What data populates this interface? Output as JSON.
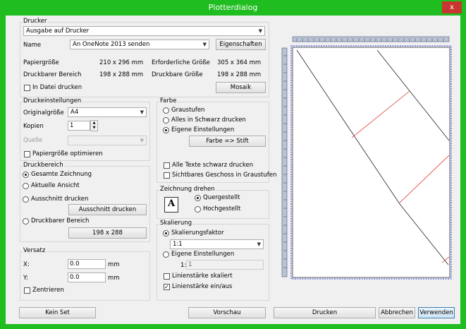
{
  "window": {
    "title": "Plotterdialog",
    "close_label": "x"
  },
  "drucker": {
    "group_title": "Drucker",
    "output_select": "Ausgabe auf Drucker",
    "name_label": "Name",
    "name_select": "An OneNote 2013 senden",
    "properties_button": "Eigenschaften",
    "papiergroesse_label": "Papiergröße",
    "papiergroesse_value": "210 x 296 mm",
    "erforderlich_label": "Erforderliche Größe",
    "erforderlich_value": "305 x 364 mm",
    "druckbar_bereich_label": "Druckbarer Bereich",
    "druckbar_bereich_value": "198 x 288 mm",
    "druckbare_groesse_label": "Druckbare Größe",
    "druckbare_groesse_value": "198 x 288 mm",
    "in_datei_label": "In Datei drucken",
    "mosaik_button": "Mosaik"
  },
  "druckeinstellungen": {
    "group_title": "Druckeinstellungen",
    "originalgroesse_label": "Originalgröße",
    "originalgroesse_value": "A4",
    "kopien_label": "Kopien",
    "kopien_value": "1",
    "quelle_label": "Quelle",
    "papiergroesse_opt_label": "Papiergröße optimieren"
  },
  "druckbereich": {
    "group_title": "Druckbereich",
    "gesamte_label": "Gesamte Zeichnung",
    "aktuelle_label": "Aktuelle Ansicht",
    "ausschnitt_label": "Ausschnitt drucken",
    "ausschnitt_button": "Ausschnitt drucken",
    "druckbarer_label": "Druckbarer Bereich",
    "druckbarer_button": "198 x 288"
  },
  "versatz": {
    "group_title": "Versatz",
    "x_label": "X:",
    "x_value": "0.0",
    "y_label": "Y:",
    "y_value": "0.0",
    "unit": "mm",
    "zentrieren_label": "Zentrieren"
  },
  "farbe": {
    "group_title": "Farbe",
    "graustufen_label": "Graustufen",
    "schwarz_label": "Alles in Schwarz drucken",
    "eigene_label": "Eigene Einstellungen",
    "stift_button": "Farbe => Stift",
    "texte_label": "Alle Texte schwarz drucken",
    "geschoss_label": "Sichtbares Geschoss in Graustufen"
  },
  "drehen": {
    "group_title": "Zeichnung drehen",
    "quer_label": "Quergestellt",
    "hoch_label": "Hochgestellt",
    "icon_letter": "A"
  },
  "skalierung": {
    "group_title": "Skalierung",
    "faktor_label": "Skalierungsfaktor",
    "faktor_value": "1:1",
    "eigene_label": "Eigene Einstellungen",
    "eigene_prefix": "1:",
    "eigene_value": "1",
    "skaliert_label": "Linienstärke skaliert",
    "einaus_label": "Linienstärke ein/aus"
  },
  "footer": {
    "kein_set": "Kein Set",
    "vorschau": "Vorschau",
    "drucken": "Drucken",
    "abbrechen": "Abbrechen",
    "verwenden": "Verwenden"
  }
}
